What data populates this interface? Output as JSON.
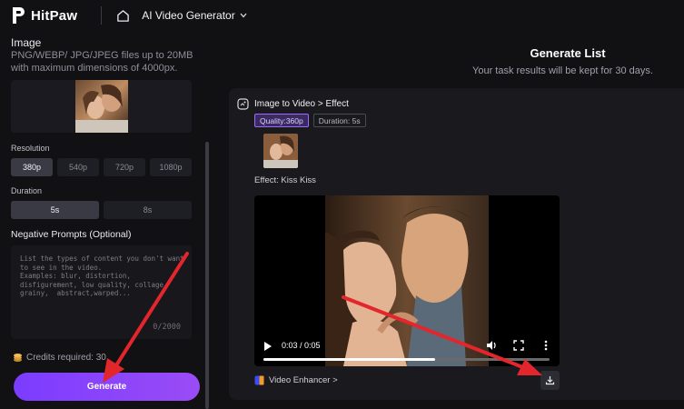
{
  "app": {
    "name": "HitPaw",
    "tool_selector": "AI Video Generator"
  },
  "left_panel": {
    "image_title": "Image",
    "image_hint": "PNG/WEBP/ JPG/JPEG files up to 20MB with maximum dimensions of 4000px.",
    "resolution_title": "Resolution",
    "resolution_options": [
      "380p",
      "540p",
      "720p",
      "1080p"
    ],
    "resolution_selected": "380p",
    "duration_title": "Duration",
    "duration_options": [
      "5s",
      "8s"
    ],
    "duration_selected": "5s",
    "negative_title": "Negative Prompts (Optional)",
    "negative_placeholder": "List the types of content you don't want\nto see in the video.\nExamples: blur, distortion,\ndisfigurement, low quality, collage,\ngrainy,  abstract,warped...",
    "negative_count": "0/2000",
    "credits": "Credits required: 30",
    "generate_label": "Generate"
  },
  "right_panel": {
    "title": "Generate List",
    "subtitle": "Your task results will be kept for 30 days.",
    "task": {
      "breadcrumb": "Image to Video > Effect",
      "quality_tag": "Quality:360p",
      "duration_tag": "Duration: 5s",
      "effect_label": "Effect: Kiss Kiss",
      "video_time": "0:03 / 0:05",
      "video_progress": 0.6,
      "enhancer_label": "Video Enhancer >"
    }
  },
  "colors": {
    "accent": "#7b3cff",
    "annotation_arrow": "#e3262b"
  }
}
